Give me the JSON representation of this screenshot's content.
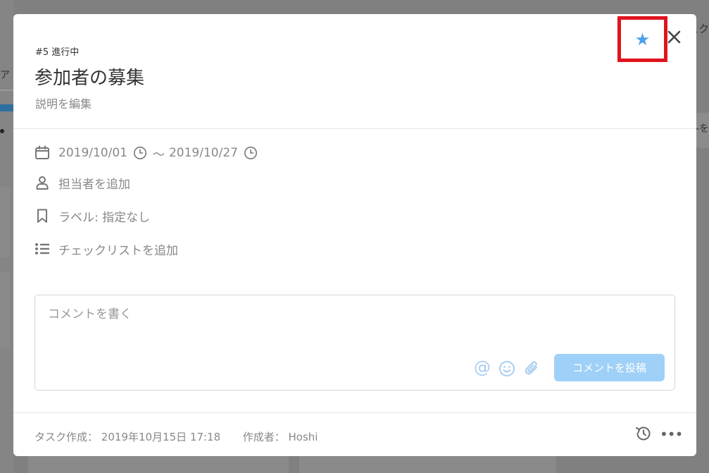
{
  "task": {
    "status": "#5 進行中",
    "title": "参加者の募集",
    "edit_description": "説明を編集"
  },
  "details": {
    "start_date": "2019/10/01",
    "date_separator": "～",
    "end_date": "2019/10/27",
    "assignee": "担当者を追加",
    "label": "ラベル: 指定なし",
    "checklist": "チェックリストを追加"
  },
  "comment": {
    "placeholder": "コメントを書く",
    "post_label": "コメントを投稿",
    "at_symbol": "@"
  },
  "footer": {
    "created_label": "タスク作成：",
    "created_value": "2019年10月15日 17:18",
    "author_label": "作成者：",
    "author_value": "Hoshi",
    "more_symbol": "•••"
  },
  "header_actions": {
    "star_symbol": "★",
    "star_highlighted": true
  },
  "background": {
    "left_fragment": "ア・",
    "right_fragment": "スク",
    "right_fragment2": "-を"
  },
  "colors": {
    "accent_blue": "#4a9fe8",
    "post_button": "#9fd0f7",
    "highlight_red": "#e0141e",
    "muted_text": "#888888"
  }
}
